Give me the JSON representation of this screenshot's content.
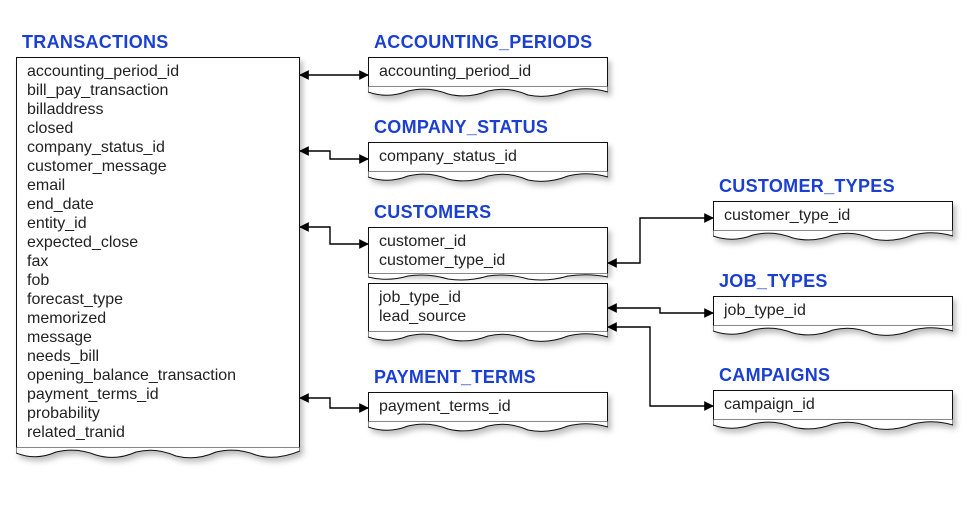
{
  "diagram": {
    "type": "entity-relationship",
    "tables": {
      "transactions": {
        "title": "TRANSACTIONS",
        "columns": [
          "accounting_period_id",
          "bill_pay_transaction",
          "billaddress",
          "closed",
          "company_status_id",
          "customer_message",
          "email",
          "end_date",
          "entity_id",
          "expected_close",
          "fax",
          "fob",
          "forecast_type",
          "memorized",
          "message",
          "needs_bill",
          "opening_balance_transaction",
          "payment_terms_id",
          "probability",
          "related_tranid"
        ]
      },
      "accounting_periods": {
        "title": "ACCOUNTING_PERIODS",
        "columns": [
          "accounting_period_id"
        ]
      },
      "company_status": {
        "title": "COMPANY_STATUS",
        "columns": [
          "company_status_id"
        ]
      },
      "customers": {
        "title": "CUSTOMERS",
        "columns_top": [
          "customer_id",
          "customer_type_id"
        ],
        "columns_bottom": [
          "job_type_id",
          "lead_source"
        ]
      },
      "payment_terms": {
        "title": "PAYMENT_TERMS",
        "columns": [
          "payment_terms_id"
        ]
      },
      "customer_types": {
        "title": "CUSTOMER_TYPES",
        "columns": [
          "customer_type_id"
        ]
      },
      "job_types": {
        "title": "JOB_TYPES",
        "columns": [
          "job_type_id"
        ]
      },
      "campaigns": {
        "title": "CAMPAIGNS",
        "columns": [
          "campaign_id"
        ]
      }
    },
    "relationships": [
      {
        "from": "TRANSACTIONS.accounting_period_id",
        "to": "ACCOUNTING_PERIODS.accounting_period_id"
      },
      {
        "from": "TRANSACTIONS.company_status_id",
        "to": "COMPANY_STATUS.company_status_id"
      },
      {
        "from": "TRANSACTIONS.entity_id",
        "to": "CUSTOMERS.customer_id"
      },
      {
        "from": "TRANSACTIONS.payment_terms_id",
        "to": "PAYMENT_TERMS.payment_terms_id"
      },
      {
        "from": "CUSTOMERS.customer_type_id",
        "to": "CUSTOMER_TYPES.customer_type_id"
      },
      {
        "from": "CUSTOMERS.job_type_id",
        "to": "JOB_TYPES.job_type_id"
      },
      {
        "from": "CUSTOMERS.lead_source",
        "to": "CAMPAIGNS.campaign_id"
      }
    ]
  }
}
